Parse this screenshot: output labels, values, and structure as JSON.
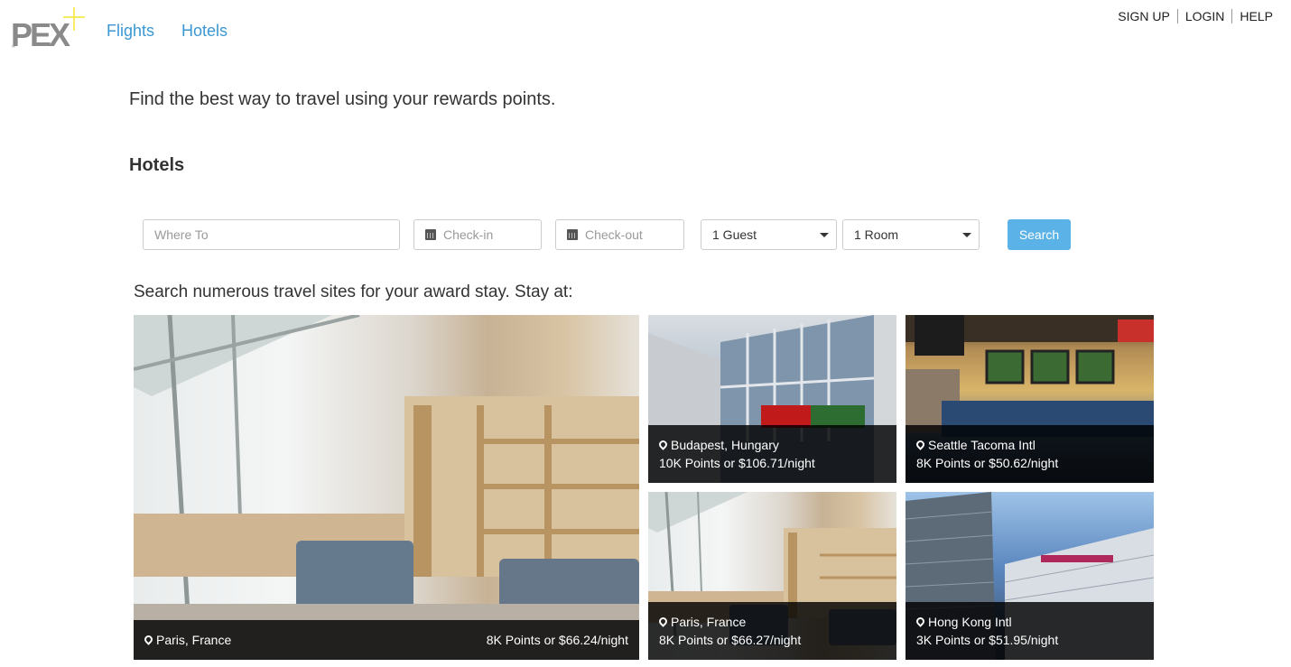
{
  "header": {
    "logo_text": "PEX",
    "logo_tm": "™",
    "nav": [
      {
        "label": "Flights"
      },
      {
        "label": "Hotels"
      }
    ],
    "account_links": [
      {
        "label": "SIGN UP"
      },
      {
        "label": "LOGIN"
      },
      {
        "label": "HELP"
      }
    ]
  },
  "tagline": "Find the best way to travel using your rewards points.",
  "section_title": "Hotels",
  "search": {
    "where_placeholder": "Where To",
    "checkin_placeholder": "Check-in",
    "checkout_placeholder": "Check-out",
    "guests_value": "1 Guest",
    "rooms_value": "1 Room",
    "button_label": "Search"
  },
  "subheading": "Search numerous travel sites for your award stay. Stay at:",
  "tiles": [
    {
      "location": "Paris, France",
      "price": "8K Points or $66.24/night"
    },
    {
      "location": "Budapest, Hungary",
      "price": "10K Points or $106.71/night"
    },
    {
      "location": "Seattle Tacoma Intl",
      "price": "8K Points or $50.62/night"
    },
    {
      "location": "Paris, France",
      "price": "8K Points or $66.27/night"
    },
    {
      "location": "Hong Kong Intl",
      "price": "3K Points or $51.95/night"
    }
  ],
  "colors": {
    "link_blue": "#3a97d4",
    "button_blue": "#5bb2e6",
    "logo_plus": "#f2e632"
  },
  "icons": [
    "map-marker-icon",
    "calendar-icon",
    "caret-down-icon"
  ]
}
